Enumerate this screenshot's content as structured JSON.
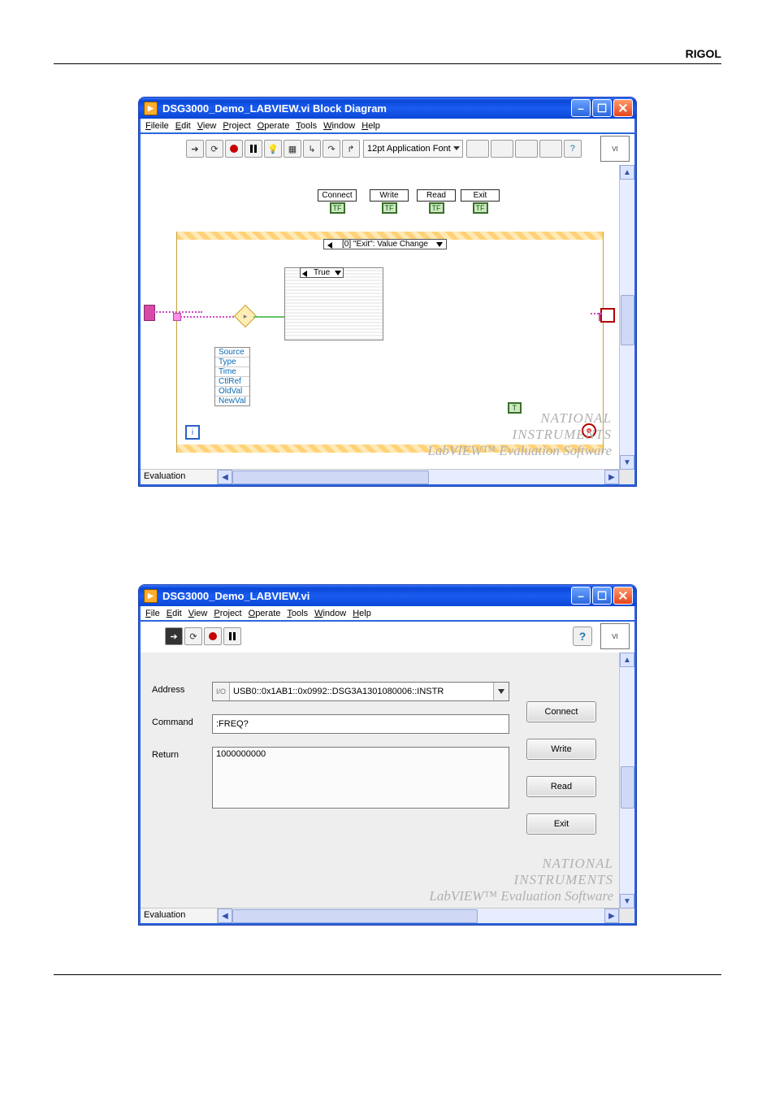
{
  "page": {
    "brand": "RIGOL"
  },
  "window1": {
    "title": "DSG3000_Demo_LABVIEW.vi Block Diagram",
    "menus": [
      "File",
      "Edit",
      "View",
      "Project",
      "Operate",
      "Tools",
      "Window",
      "Help"
    ],
    "font_selector": "12pt Application Font",
    "status_label": "Evaluation",
    "diagram": {
      "buttons": [
        {
          "label": "Connect",
          "tf": "TF"
        },
        {
          "label": "Write",
          "tf": "TF"
        },
        {
          "label": "Read",
          "tf": "TF"
        },
        {
          "label": "Exit",
          "tf": "TF"
        }
      ],
      "event_case": "[0] \"Exit\": Value Change",
      "case_value": "True",
      "cluster_items": [
        "Source",
        "Type",
        "Time",
        "CtlRef",
        "OldVal",
        "NewVal"
      ],
      "loop_index_label": "i"
    },
    "watermark": {
      "l1": "NATIONAL",
      "l2": "INSTRUMENTS",
      "l3": "LabVIEW™ Evaluation Software"
    }
  },
  "window2": {
    "title": "DSG3000_Demo_LABVIEW.vi",
    "menus": [
      "File",
      "Edit",
      "View",
      "Project",
      "Operate",
      "Tools",
      "Window",
      "Help"
    ],
    "status_label": "Evaluation",
    "fields": {
      "address_label": "Address",
      "address_value": "USB0::0x1AB1::0x0992::DSG3A1301080006::INSTR",
      "command_label": "Command",
      "command_value": ":FREQ?",
      "return_label": "Return",
      "return_value": "1000000000"
    },
    "buttons": {
      "connect": "Connect",
      "write": "Write",
      "read": "Read",
      "exit": "Exit"
    },
    "watermark": {
      "l1": "NATIONAL",
      "l2": "INSTRUMENTS",
      "l3": "LabVIEW™ Evaluation Software"
    }
  }
}
